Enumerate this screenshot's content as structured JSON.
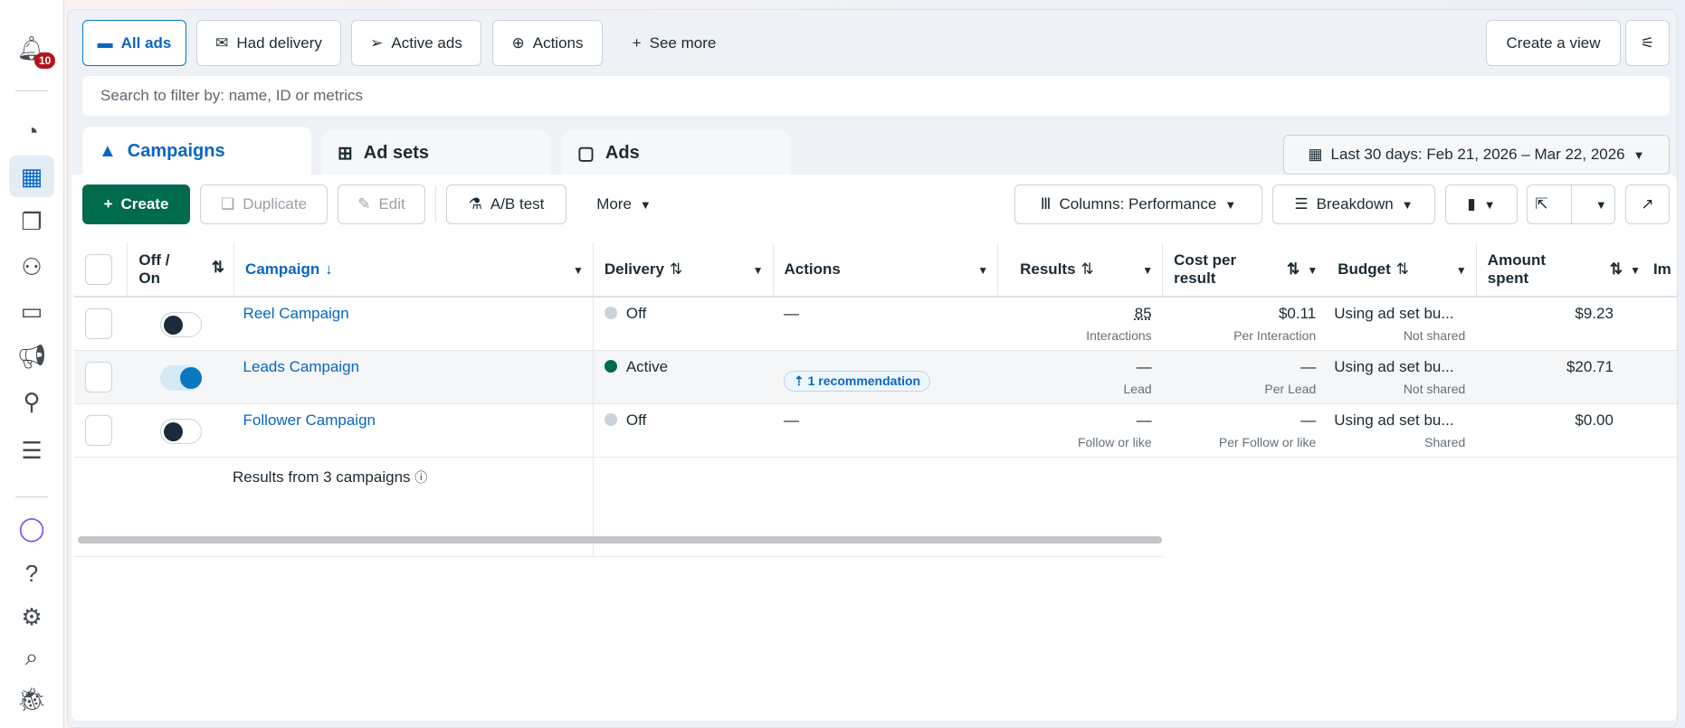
{
  "sidebar": {
    "notification_count": "10",
    "items": [
      "notifications",
      "dashboard",
      "campaigns-table",
      "pages",
      "audiences",
      "billing",
      "ads-manager",
      "events",
      "all-tools",
      "meta-ai",
      "help",
      "settings",
      "search",
      "report-bug"
    ]
  },
  "filters": {
    "all_ads": "All ads",
    "had_delivery": "Had delivery",
    "active_ads": "Active ads",
    "actions": "Actions",
    "see_more": "See more",
    "create_view": "Create a view"
  },
  "search": {
    "placeholder": "Search to filter by: name, ID or metrics"
  },
  "tabs": {
    "campaigns": "Campaigns",
    "ad_sets": "Ad sets",
    "ads": "Ads"
  },
  "date_range": "Last 30 days: Feb 21, 2026 – Mar 22, 2026",
  "toolbar": {
    "create": "Create",
    "duplicate": "Duplicate",
    "edit": "Edit",
    "ab_test": "A/B test",
    "more": "More",
    "columns": "Columns: Performance",
    "breakdown": "Breakdown"
  },
  "table": {
    "headers": {
      "toggle_1": "Off /",
      "toggle_2": "On",
      "campaign": "Campaign",
      "delivery": "Delivery",
      "actions": "Actions",
      "results": "Results",
      "cost_1": "Cost per",
      "cost_2": "result",
      "budget": "Budget",
      "amount_1": "Amount",
      "amount_2": "spent",
      "impressions": "Im"
    },
    "rows": [
      {
        "name": "Reel Campaign",
        "on": false,
        "delivery": "Off",
        "action": "—",
        "results": "85",
        "results_sub": "Interactions",
        "cost": "$0.11",
        "cost_sub": "Per Interaction",
        "budget": "Using ad set bu...",
        "budget_sub": "Not shared",
        "spent": "$9.23"
      },
      {
        "name": "Leads Campaign",
        "on": true,
        "delivery": "Active",
        "action": "1 recommendation",
        "results": "—",
        "results_sub": "Lead",
        "cost": "—",
        "cost_sub": "Per Lead",
        "budget": "Using ad set bu...",
        "budget_sub": "Not shared",
        "spent": "$20.71"
      },
      {
        "name": "Follower Campaign",
        "on": false,
        "delivery": "Off",
        "action": "—",
        "results": "—",
        "results_sub": "Follow or like",
        "cost": "—",
        "cost_sub": "Per Follow or like",
        "budget": "Using ad set bu...",
        "budget_sub": "Shared",
        "spent": "$0.00"
      }
    ],
    "footer": "Results from 3 campaigns"
  },
  "colors": {
    "accent": "#0a66c2",
    "create": "#006b4c",
    "active": "#006b4c",
    "off": "#cbd2d9"
  }
}
